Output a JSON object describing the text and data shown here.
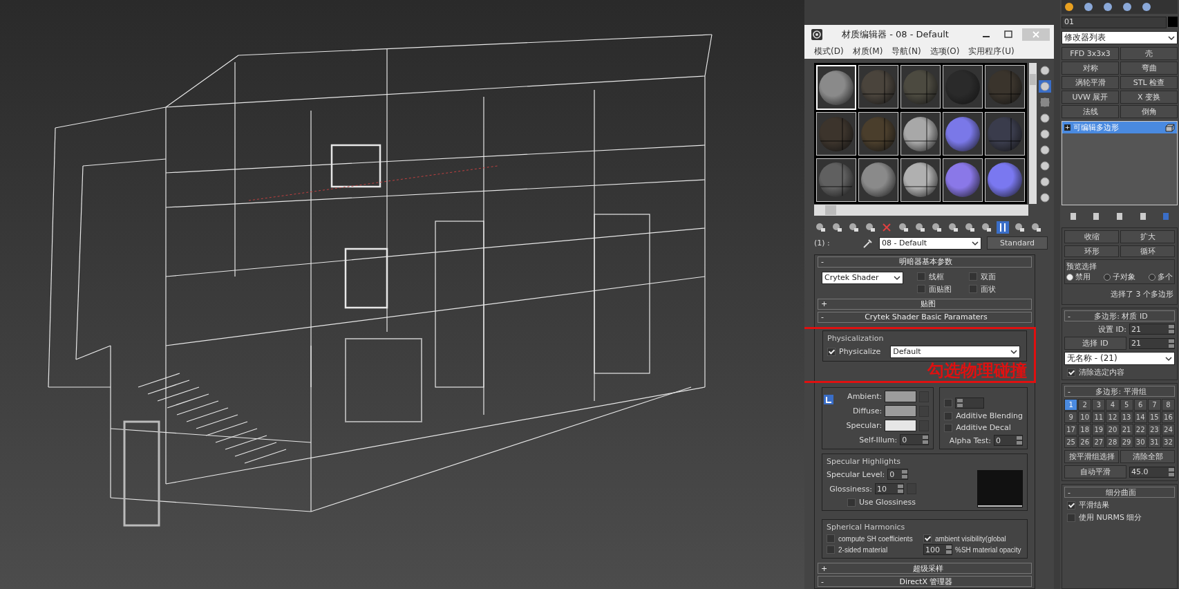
{
  "material_editor": {
    "title": "材质编辑器 - 08 - Default",
    "menu": [
      "模式(D)",
      "材质(M)",
      "导航(N)",
      "选项(O)",
      "实用程序(U)"
    ],
    "samples": [
      {
        "kind": "plain",
        "color": "#8a8a8a",
        "selected": true
      },
      {
        "kind": "textured",
        "color": "#4a443c",
        "selected": false
      },
      {
        "kind": "textured",
        "color": "#4c4a40",
        "selected": false
      },
      {
        "kind": "plain",
        "color": "#2a2a2a",
        "selected": false
      },
      {
        "kind": "textured",
        "color": "#3a342c",
        "selected": false
      },
      {
        "kind": "textured",
        "color": "#3c342c",
        "selected": false
      },
      {
        "kind": "textured",
        "color": "#4a3e2c",
        "selected": false
      },
      {
        "kind": "textured",
        "color": "#a8a8a8",
        "selected": false
      },
      {
        "kind": "plain",
        "color": "#7a78e8",
        "selected": false
      },
      {
        "kind": "textured",
        "color": "#3a3c4c",
        "selected": false
      },
      {
        "kind": "textured",
        "color": "#606060",
        "selected": false
      },
      {
        "kind": "plain",
        "color": "#8a8a8a",
        "selected": false
      },
      {
        "kind": "textured",
        "color": "#b0b0b0",
        "selected": false
      },
      {
        "kind": "plain",
        "color": "#8a78e8",
        "selected": false
      },
      {
        "kind": "plain",
        "color": "#7a78f0",
        "selected": false
      }
    ],
    "slot": "(1) :",
    "material_name": "08 - Default",
    "material_type": "Standard",
    "shader_rollout": {
      "sign": "-",
      "title": "明暗器基本参数",
      "shader": "Crytek Shader",
      "options": [
        {
          "label": "线框",
          "checked": false
        },
        {
          "label": "双面",
          "checked": false
        },
        {
          "label": "面贴图",
          "checked": false
        },
        {
          "label": "面状",
          "checked": false
        }
      ]
    },
    "maps_rollout": {
      "sign": "+",
      "title": "贴图"
    },
    "crytek_rollout": {
      "sign": "-",
      "title": "Crytek Shader Basic Paramaters",
      "physicalization": {
        "title": "Physicalization",
        "label": "Physicalize",
        "checked": true,
        "mode": "Default"
      },
      "colors": [
        {
          "label": "Ambient:",
          "color": "#9c9c9c"
        },
        {
          "label": "Diffuse:",
          "color": "#9c9c9c"
        },
        {
          "label": "Specular:",
          "color": "#e6e6e6"
        }
      ],
      "opacity_checked": false,
      "self_illum": {
        "label": "Self-Illum:",
        "value": "0"
      },
      "blending": [
        {
          "label": "Additive Blending",
          "checked": false
        },
        {
          "label": "Additive Decal",
          "checked": false
        }
      ],
      "alpha_test": {
        "label": "Alpha Test:",
        "value": "0"
      },
      "specular": {
        "title": "Specular Highlights",
        "level": {
          "label": "Specular Level:",
          "value": "0"
        },
        "glossiness": {
          "label": "Glossiness:",
          "value": "10"
        },
        "use_glossiness": {
          "label": "Use Glossiness",
          "checked": false
        }
      },
      "harmonics": {
        "title": "Spherical Harmonics",
        "options": [
          {
            "label": "compute SH coefficients",
            "checked": false
          },
          {
            "label": "ambient visibility(global",
            "checked": true
          },
          {
            "label": "2-sided material",
            "checked": false
          }
        ],
        "opacity_value": "100",
        "opacity_label": "%SH material opacity"
      }
    },
    "more_rollouts": [
      {
        "sign": "+",
        "title": "超级采样"
      },
      {
        "sign": "-",
        "title": "DirectX 管理器"
      }
    ],
    "annotation": "勾选物理碰撞"
  },
  "command_panel": {
    "object_name": "01",
    "modifier_list": "修改器列表",
    "modifier_buttons": [
      "FFD 3x3x3",
      "壳",
      "对称",
      "弯曲",
      "涡轮平滑",
      "STL 检查",
      "UVW 展开",
      "X 变换",
      "法线",
      "倒角"
    ],
    "stack": [
      {
        "sign": "+",
        "label": "可编辑多边形",
        "selected": true
      }
    ],
    "selection": {
      "buttons": [
        "收缩",
        "扩大"
      ],
      "spin_buttons": [
        "环形",
        "循环"
      ],
      "preview_title": "预览选择",
      "preview": [
        {
          "label": "禁用",
          "selected": true
        },
        {
          "label": "子对象",
          "selected": false
        },
        {
          "label": "多个",
          "selected": false
        }
      ],
      "status": "选择了 3 个多边形"
    },
    "material_id": {
      "sign": "-",
      "title": "多边形: 材质 ID",
      "set_label": "设置 ID:",
      "set_value": "21",
      "select_button": "选择 ID",
      "select_value": "21",
      "name": "无名称 - (21)",
      "clear": {
        "label": "清除选定内容",
        "checked": true
      }
    },
    "smoothing": {
      "sign": "-",
      "title": "多边形: 平滑组",
      "groups": [
        {
          "label": "1",
          "selected": true
        },
        {
          "label": "2",
          "selected": false
        },
        {
          "label": "3",
          "selected": false
        },
        {
          "label": "4",
          "selected": false
        },
        {
          "label": "5",
          "selected": false
        },
        {
          "label": "6",
          "selected": false
        },
        {
          "label": "7",
          "selected": false
        },
        {
          "label": "8",
          "selected": false
        },
        {
          "label": "9",
          "selected": false
        },
        {
          "label": "10",
          "selected": false
        },
        {
          "label": "11",
          "selected": false
        },
        {
          "label": "12",
          "selected": false
        },
        {
          "label": "13",
          "selected": false
        },
        {
          "label": "14",
          "selected": false
        },
        {
          "label": "15",
          "selected": false
        },
        {
          "label": "16",
          "selected": false
        },
        {
          "label": "17",
          "selected": false
        },
        {
          "label": "18",
          "selected": false
        },
        {
          "label": "19",
          "selected": false
        },
        {
          "label": "20",
          "selected": false
        },
        {
          "label": "21",
          "selected": false
        },
        {
          "label": "22",
          "selected": false
        },
        {
          "label": "23",
          "selected": false
        },
        {
          "label": "24",
          "selected": false
        },
        {
          "label": "25",
          "selected": false
        },
        {
          "label": "26",
          "selected": false
        },
        {
          "label": "27",
          "selected": false
        },
        {
          "label": "28",
          "selected": false
        },
        {
          "label": "29",
          "selected": false
        },
        {
          "label": "30",
          "selected": false
        },
        {
          "label": "31",
          "selected": false
        },
        {
          "label": "32",
          "selected": false
        }
      ],
      "buttons": [
        "按平滑组选择",
        "清除全部"
      ],
      "auto_button": "自动平滑",
      "auto_value": "45.0"
    },
    "subdivision": {
      "sign": "-",
      "title": "细分曲面",
      "options": [
        {
          "label": "平滑结果",
          "checked": true
        },
        {
          "label": "使用 NURMS 细分",
          "checked": false
        }
      ]
    }
  }
}
